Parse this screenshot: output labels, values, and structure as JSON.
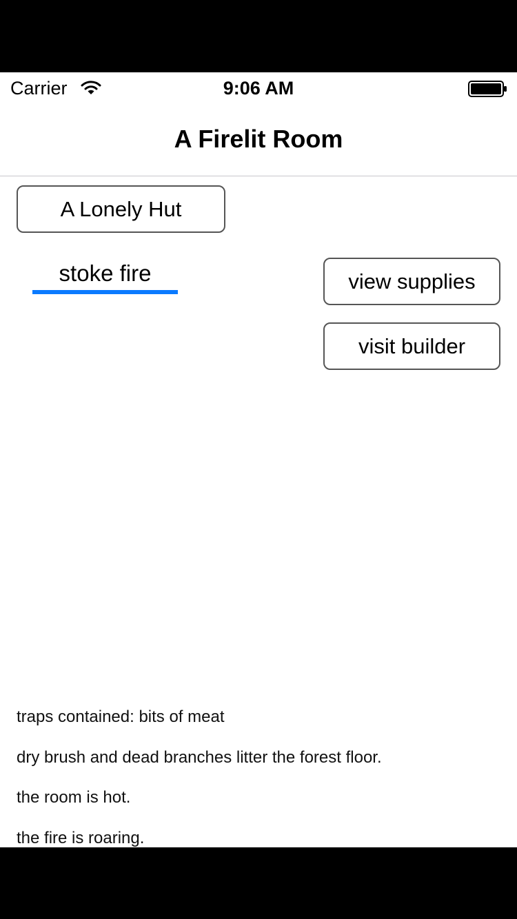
{
  "status_bar": {
    "carrier": "Carrier",
    "time": "9:06 AM",
    "wifi_icon": "wifi-icon",
    "battery_icon": "battery-full-icon"
  },
  "nav": {
    "title": "A Firelit Room"
  },
  "buttons": {
    "lonely_hut": "A Lonely Hut",
    "stoke_fire": "stoke fire",
    "view_supplies": "view supplies",
    "visit_builder": "visit builder"
  },
  "stoke_fire_progress": 1.0,
  "log": [
    "traps contained: bits of meat",
    "dry brush and dead branches litter the forest floor.",
    "the room is hot.",
    "the fire is roaring."
  ],
  "colors": {
    "accent": "#0a7aff",
    "button_border": "#555555",
    "background": "#ffffff"
  }
}
